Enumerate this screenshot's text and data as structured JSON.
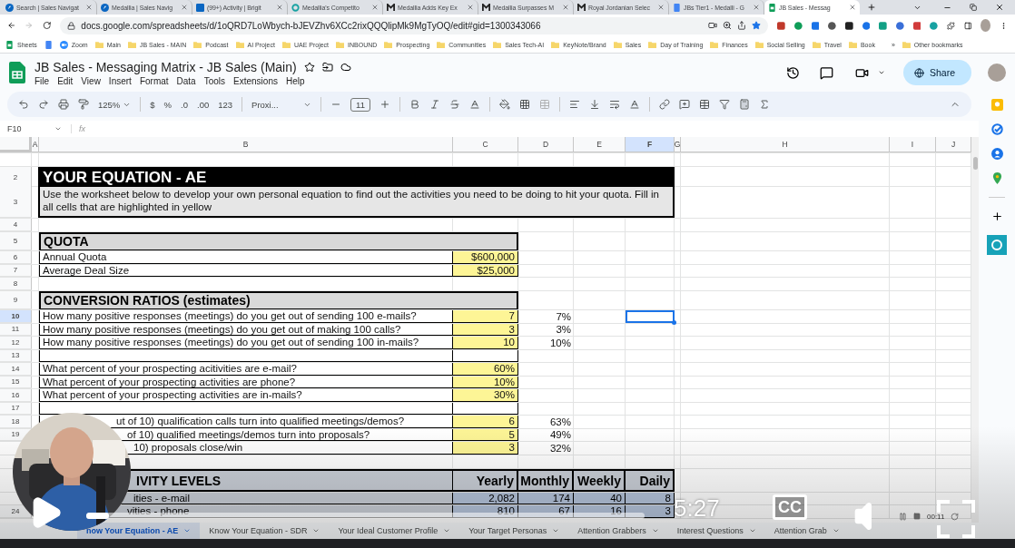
{
  "browser": {
    "tabs": [
      {
        "title": "Search | Sales Navigat",
        "kind": "navigator",
        "selected": false
      },
      {
        "title": "Medallia | Sales Navig",
        "kind": "navigator",
        "selected": false
      },
      {
        "title": "(99+) Activity | Brigit",
        "kind": "linkedin",
        "selected": false
      },
      {
        "title": "Medallia's Competito",
        "kind": "ring",
        "selected": false
      },
      {
        "title": "Medallia Adds Key Ex",
        "kind": "medallia",
        "selected": false
      },
      {
        "title": "Medallia Surpasses M",
        "kind": "medallia",
        "selected": false
      },
      {
        "title": "Royal Jordanian Selec",
        "kind": "medallia",
        "selected": false
      },
      {
        "title": "JBs Tier1 - Medalli - G",
        "kind": "docs",
        "selected": false
      },
      {
        "title": "JB Sales - Messag",
        "kind": "sheets",
        "selected": true
      }
    ],
    "url": "docs.google.com/spreadsheets/d/1oQRD7LoWbych-bJEVZhv6XCc2rixQQQlipMk9MgTyOQ/edit#gid=1300343066",
    "bookmarks": [
      {
        "label": "Sheets",
        "kind": "sheets"
      },
      {
        "kind": "docs"
      },
      {
        "label": "Zoom",
        "kind": "zoom"
      },
      {
        "label": "Main",
        "kind": "folder"
      },
      {
        "label": "JB Sales - MAIN",
        "kind": "folder"
      },
      {
        "label": "Podcast",
        "kind": "folder"
      },
      {
        "label": "AI Project",
        "kind": "folder"
      },
      {
        "label": "UAE Project",
        "kind": "folder"
      },
      {
        "label": "INBOUND",
        "kind": "folder"
      },
      {
        "label": "Prospecting",
        "kind": "folder"
      },
      {
        "label": "Communities",
        "kind": "folder"
      },
      {
        "label": "Sales Tech-AI",
        "kind": "folder"
      },
      {
        "label": "KeyNote/Brand",
        "kind": "folder"
      },
      {
        "label": "Sales",
        "kind": "folder"
      },
      {
        "label": "Day of Training",
        "kind": "folder"
      },
      {
        "label": "Finances",
        "kind": "folder"
      },
      {
        "label": "Social Selling",
        "kind": "folder"
      },
      {
        "label": "Travel",
        "kind": "folder"
      },
      {
        "label": "Book",
        "kind": "folder"
      },
      {
        "label": "»",
        "kind": "more"
      },
      {
        "label": "Other bookmarks",
        "kind": "folder"
      }
    ]
  },
  "sheet": {
    "title": "JB Sales - Messaging Matrix - JB Sales (Main)",
    "menu": [
      "File",
      "Edit",
      "View",
      "Insert",
      "Format",
      "Data",
      "Tools",
      "Extensions",
      "Help"
    ],
    "share": "Share",
    "toolbar": {
      "zoom": "125%",
      "currency": "$",
      "percent": "%",
      "decrease_decimal": ".0",
      "increase_decimal": ".00",
      "number_format": "123",
      "font": "Proxi...",
      "font_size": "11"
    },
    "cell_ref": "F10",
    "fx": "fx",
    "columns": [
      {
        "label": "A",
        "selected": false
      },
      {
        "label": "B",
        "selected": false
      },
      {
        "label": "C",
        "selected": false
      },
      {
        "label": "D",
        "selected": false
      },
      {
        "label": "E",
        "selected": false
      },
      {
        "label": "F",
        "selected": true
      },
      {
        "label": "G",
        "selected": false
      },
      {
        "label": "H",
        "selected": false
      },
      {
        "label": "I",
        "selected": false
      },
      {
        "label": "J",
        "selected": false
      }
    ],
    "rows": [
      {
        "kind": "blank"
      },
      {
        "number": "2",
        "kind": "title",
        "text": "YOUR EQUATION - AE"
      },
      {
        "number": "3",
        "kind": "note",
        "text": "Use the worksheet below to develop your own personal equation to find out the activities you need to be doing to hit your quota. Fill in all cells that are highlighted in yellow"
      },
      {
        "number": "4",
        "kind": "blank"
      },
      {
        "number": "5",
        "kind": "section",
        "text": "QUOTA"
      },
      {
        "number": "6",
        "kind": "item",
        "label": "Annual Quota",
        "value": "$600,000",
        "highlighted": true
      },
      {
        "number": "7",
        "kind": "item",
        "label": "Average Deal Size",
        "value": "$25,000",
        "highlighted": true
      },
      {
        "number": "8",
        "kind": "blank"
      },
      {
        "number": "9",
        "kind": "section",
        "text": "CONVERSION RATIOS (estimates)"
      },
      {
        "number": "10",
        "kind": "item",
        "label": "How many positive responses (meetings) do you get out of sending 100 e-mails?",
        "value": "7",
        "percent": "7%",
        "highlighted": true,
        "selected": true
      },
      {
        "number": "11",
        "kind": "item",
        "label": "How many positive responses (meetings) do you get out of making 100 calls?",
        "value": "3",
        "percent": "3%",
        "highlighted": true
      },
      {
        "number": "12",
        "kind": "item",
        "label": "How many positive responses (meetings) do you get out of sending 100 in-mails?",
        "value": "10",
        "percent": "10%",
        "highlighted": true
      },
      {
        "number": "13",
        "kind": "spacer"
      },
      {
        "number": "14",
        "kind": "item",
        "label": "What percent of your prospecting acitivities are e-mail?",
        "value": "60%",
        "highlighted": true
      },
      {
        "number": "15",
        "kind": "item",
        "label": "What percent of your prospecting activities are phone?",
        "value": "10%",
        "highlighted": true
      },
      {
        "number": "16",
        "kind": "item",
        "label": "What percent of your prospecting activities are in-mails?",
        "value": "30%",
        "highlighted": true
      },
      {
        "number": "17",
        "kind": "spacer"
      },
      {
        "number": "18",
        "kind": "item",
        "label": "ut of 10) qualification calls turn into qualified meetings/demos?",
        "value": "6",
        "percent": "63%",
        "highlighted": true,
        "clipped": true
      },
      {
        "number": "19",
        "kind": "item",
        "label": "of 10) qualified meetings/demos turn into proposals?",
        "value": "5",
        "percent": "49%",
        "highlighted": true,
        "clipped": true
      },
      {
        "kind": "item",
        "label": "10) proposals close/win",
        "value": "3",
        "percent": "32%",
        "highlighted": true,
        "clipped": true
      },
      {
        "kind": "blank"
      },
      {
        "kind": "activity_header",
        "label": "IVITY LEVELS",
        "columns": [
          "Yearly",
          "Monthly",
          "Weekly",
          "Daily"
        ],
        "clipped": true
      },
      {
        "kind": "activity",
        "label": "ities - e-mail",
        "values": [
          "2,082",
          "174",
          "40",
          "8"
        ],
        "clipped": true
      },
      {
        "number": "24",
        "kind": "activity",
        "label": "vities - phone",
        "values": [
          "810",
          "67",
          "16",
          "3"
        ],
        "clipped": true
      }
    ],
    "tabs": [
      {
        "label": "now Your Equation - AE",
        "selected": true
      },
      {
        "label": "Know Your Equation - SDR",
        "selected": false
      },
      {
        "label": "Your Ideal Customer Profile",
        "selected": false
      },
      {
        "label": "Your Target Personas",
        "selected": false
      },
      {
        "label": "Attention Grabbers",
        "selected": false
      },
      {
        "label": "Interest Questions",
        "selected": false
      },
      {
        "label": "Attention Grab",
        "selected": false
      }
    ]
  },
  "video": {
    "level": 0.04,
    "time": "5:27",
    "captions": "CC",
    "recorder_time": "00:11"
  }
}
